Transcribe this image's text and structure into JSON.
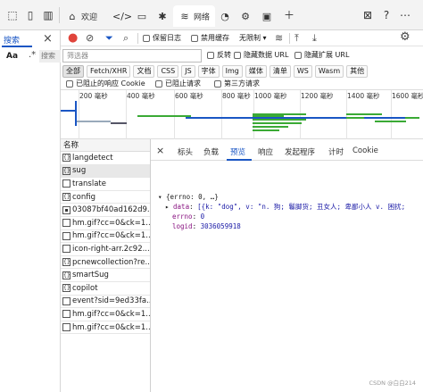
{
  "top_tabs": [
    {
      "icon": "home-icon",
      "glyph": "⌂",
      "label": "欢迎"
    },
    {
      "icon": "code-icon",
      "glyph": "</>",
      "label": ""
    },
    {
      "icon": "console-icon",
      "glyph": "▭",
      "label": ""
    },
    {
      "icon": "bug-icon",
      "glyph": "✱",
      "label": ""
    },
    {
      "icon": "wifi-icon",
      "glyph": "≋",
      "label": "网络"
    },
    {
      "icon": "performance-icon",
      "glyph": "◔",
      "label": ""
    },
    {
      "icon": "settings-gear-icon",
      "glyph": "⚙",
      "label": ""
    },
    {
      "icon": "application-icon",
      "glyph": "▣",
      "label": ""
    }
  ],
  "sidebar": {
    "tab_label": "搜索",
    "aa": "Aa",
    "regex": ".*",
    "search_placeholder": "搜索"
  },
  "toolbar": {
    "preserve_log": "保留日志",
    "disable_cache": "禁用缓存",
    "throttle": "无限制"
  },
  "filter": {
    "placeholder": "筛选器",
    "invert": "反转",
    "hide_data_urls": "隐藏数据 URL",
    "hide_extension_urls": "隐藏扩展 URL",
    "chips": [
      "全部",
      "Fetch/XHR",
      "文档",
      "CSS",
      "JS",
      "字体",
      "Img",
      "媒体",
      "清单",
      "WS",
      "Wasm",
      "其他"
    ],
    "blocked_cookies": "已阻止的响应 Cookie",
    "blocked_requests": "已阻止请求",
    "third_party": "第三方请求"
  },
  "timeline": {
    "ticks": [
      "200 毫秒",
      "400 毫秒",
      "600 毫秒",
      "800 毫秒",
      "1000 毫秒",
      "1200 毫秒",
      "1400 毫秒",
      "1600 毫秒"
    ]
  },
  "requests": {
    "header": "名称",
    "items": [
      {
        "name": "langdetect",
        "type": "xhr"
      },
      {
        "name": "sug",
        "type": "xhr"
      },
      {
        "name": "translate",
        "type": "doc"
      },
      {
        "name": "config",
        "type": "xhr"
      },
      {
        "name": "03087bf40ad162d9...",
        "type": "img"
      },
      {
        "name": "hm.gif?cc=0&ck=1...",
        "type": "doc"
      },
      {
        "name": "hm.gif?cc=0&ck=1...",
        "type": "doc"
      },
      {
        "name": "icon-right-arr.2c92...",
        "type": "doc"
      },
      {
        "name": "pcnewcollection?re...",
        "type": "xhr"
      },
      {
        "name": "smartSug",
        "type": "xhr"
      },
      {
        "name": "copilot",
        "type": "xhr"
      },
      {
        "name": "event?sid=9ed33fa...",
        "type": "doc"
      },
      {
        "name": "hm.gif?cc=0&ck=1...",
        "type": "doc"
      },
      {
        "name": "hm.gif?cc=0&ck=1...",
        "type": "doc"
      }
    ]
  },
  "details": {
    "tabs": [
      "标头",
      "负载",
      "预览",
      "响应",
      "发起程序",
      "计时",
      "Cookie"
    ],
    "active_tab": "预览",
    "preview": {
      "line1": "▾ {errno: 0, …}",
      "line2_key": "data",
      "line2_val": "[{k: \"dog\", v: \"n. 狗; 鬈脚货; 丑女人; 卑鄙小人 v. 困扰;",
      "line3_key": "errno",
      "line3_val": "0",
      "line4_key": "logid",
      "line4_val": "3036059918"
    }
  },
  "watermark": "CSDN @白白214"
}
